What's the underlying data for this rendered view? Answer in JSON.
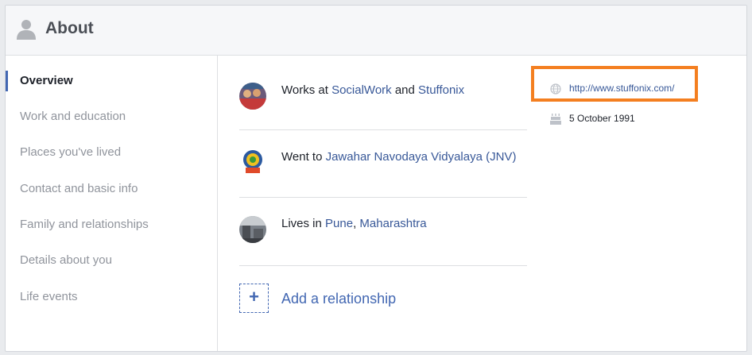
{
  "header": {
    "title": "About",
    "icon": "person-icon"
  },
  "sidebar": {
    "items": [
      {
        "label": "Overview",
        "active": true
      },
      {
        "label": "Work and education"
      },
      {
        "label": "Places you've lived"
      },
      {
        "label": "Contact and basic info"
      },
      {
        "label": "Family and relationships"
      },
      {
        "label": "Details about you"
      },
      {
        "label": "Life events"
      }
    ]
  },
  "overview": {
    "work": {
      "prefix": "Works at",
      "org1": "SocialWork",
      "conj": "and",
      "org2": "Stuffonix"
    },
    "education": {
      "prefix": "Went to",
      "school": "Jawahar Navodaya Vidyalaya (JNV)"
    },
    "lives": {
      "prefix": "Lives in",
      "city": "Pune",
      "sep": ",",
      "state": "Maharashtra"
    },
    "add_relationship": {
      "plus": "+",
      "label": "Add a relationship"
    }
  },
  "side": {
    "website": "http://www.stuffonix.com/",
    "birthday": "5 October 1991"
  },
  "colors": {
    "link": "#385898",
    "accent": "#4267b2",
    "highlight": "#f47f20"
  }
}
